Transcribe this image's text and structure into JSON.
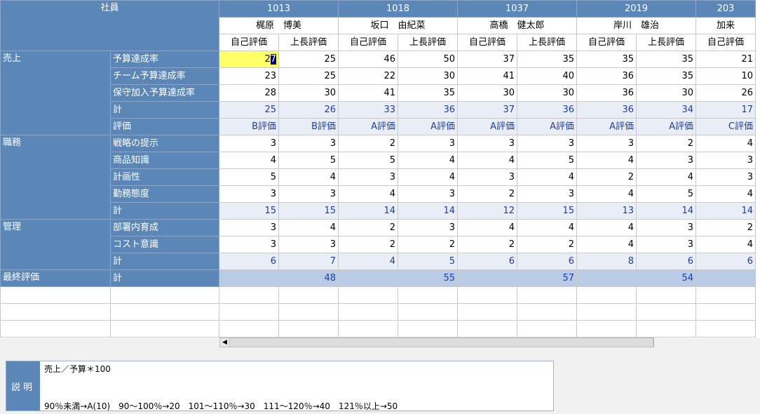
{
  "header": {
    "employee_label": "社員",
    "employees": [
      {
        "id": "1013",
        "name": "梶原　博美"
      },
      {
        "id": "1018",
        "name": "坂口　由紀菜"
      },
      {
        "id": "1037",
        "name": "高橋　健太郎"
      },
      {
        "id": "2019",
        "name": "岸川　雄治"
      },
      {
        "id": "203",
        "name": "加来"
      }
    ],
    "self_label": "自己評価",
    "boss_label": "上長評価"
  },
  "rows": [
    {
      "cat": "売上",
      "item": "予算達成率",
      "type": "data",
      "values": [
        "27",
        "25",
        "46",
        "50",
        "37",
        "35",
        "35",
        "35",
        "21"
      ]
    },
    {
      "cat": "",
      "item": "チーム予算達成率",
      "type": "data",
      "values": [
        "23",
        "25",
        "22",
        "30",
        "41",
        "40",
        "36",
        "35",
        "10"
      ]
    },
    {
      "cat": "",
      "item": "保守加入予算達成率",
      "type": "data",
      "values": [
        "28",
        "30",
        "41",
        "35",
        "30",
        "30",
        "36",
        "30",
        "26"
      ]
    },
    {
      "cat": "",
      "item": "計",
      "type": "total",
      "values": [
        "25",
        "26",
        "33",
        "36",
        "37",
        "36",
        "36",
        "34",
        "17"
      ]
    },
    {
      "cat": "",
      "item": "評価",
      "type": "grade",
      "values": [
        "B評価",
        "B評価",
        "A評価",
        "A評価",
        "A評価",
        "A評価",
        "A評価",
        "A評価",
        "C評価"
      ]
    },
    {
      "cat": "職務",
      "item": "戦略の提示",
      "type": "data",
      "values": [
        "3",
        "3",
        "2",
        "3",
        "3",
        "3",
        "3",
        "2",
        "4"
      ]
    },
    {
      "cat": "",
      "item": "商品知識",
      "type": "data",
      "values": [
        "4",
        "5",
        "5",
        "4",
        "4",
        "5",
        "4",
        "3",
        "3"
      ]
    },
    {
      "cat": "",
      "item": "計画性",
      "type": "data",
      "values": [
        "5",
        "4",
        "3",
        "4",
        "3",
        "4",
        "2",
        "4",
        "3"
      ]
    },
    {
      "cat": "",
      "item": "勤務態度",
      "type": "data",
      "values": [
        "3",
        "3",
        "4",
        "3",
        "2",
        "3",
        "4",
        "5",
        "4"
      ]
    },
    {
      "cat": "",
      "item": "計",
      "type": "total",
      "values": [
        "15",
        "15",
        "14",
        "14",
        "12",
        "15",
        "13",
        "14",
        "14"
      ]
    },
    {
      "cat": "管理",
      "item": "部署内育成",
      "type": "data",
      "values": [
        "3",
        "4",
        "2",
        "3",
        "4",
        "4",
        "4",
        "3",
        "2"
      ]
    },
    {
      "cat": "",
      "item": "コスト意識",
      "type": "data",
      "values": [
        "3",
        "3",
        "2",
        "2",
        "2",
        "2",
        "4",
        "3",
        "4"
      ]
    },
    {
      "cat": "",
      "item": "計",
      "type": "total",
      "values": [
        "6",
        "7",
        "4",
        "5",
        "6",
        "6",
        "8",
        "6",
        "6"
      ]
    },
    {
      "cat": "最終評価",
      "item": "計",
      "type": "final",
      "values": [
        "",
        "48",
        "",
        "55",
        "",
        "57",
        "",
        "54",
        ""
      ]
    }
  ],
  "description": {
    "label": "説明",
    "line1": "売上／予算＊100",
    "line2": "90％未満→A(10)　90～100％→20　101～110％→30　111～120％→40　121％以上→50"
  },
  "colors": {
    "header": "#5b86b8",
    "selected": "#ffff66",
    "total_text": "#1f3da8"
  }
}
